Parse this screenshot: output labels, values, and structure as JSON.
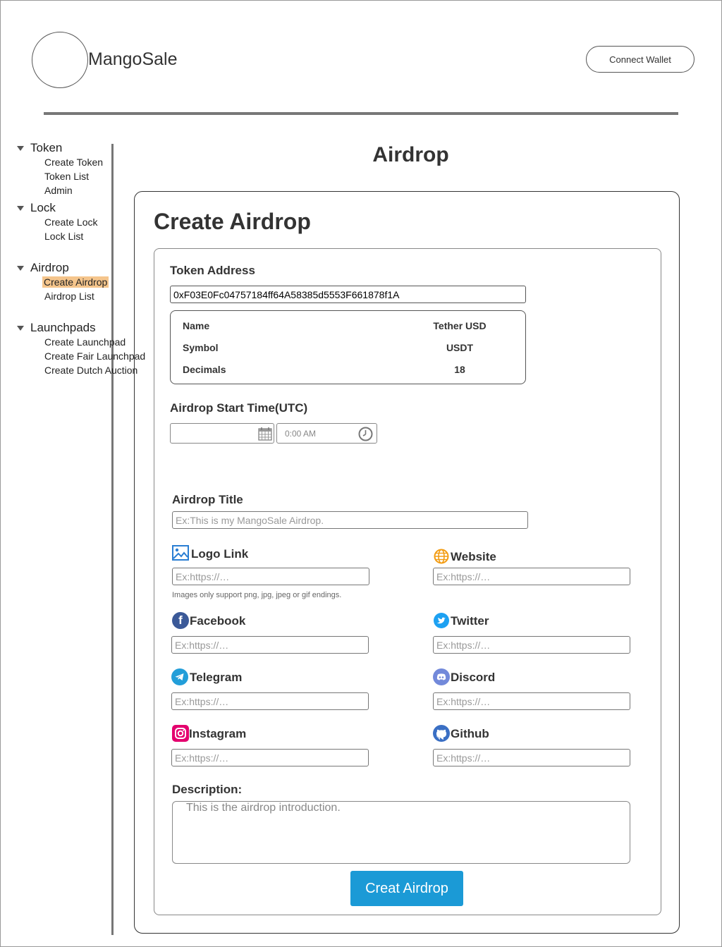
{
  "header": {
    "brand": "MangoSale",
    "connect_wallet": "Connect Wallet"
  },
  "sidebar": {
    "groups": [
      {
        "label": "Token",
        "items": [
          "Create Token",
          "Token List",
          "Admin"
        ]
      },
      {
        "label": "Lock",
        "items": [
          "Create Lock",
          "Lock List"
        ]
      },
      {
        "label": "Airdrop",
        "items": [
          "Create Airdrop",
          "Airdrop List"
        ],
        "active_item": "Create Airdrop"
      },
      {
        "label": "Launchpads",
        "items": [
          "Create Launchpad",
          "Create Fair Launchpad",
          "Create Dutch Auction"
        ]
      }
    ]
  },
  "page": {
    "title": "Airdrop",
    "card_title": "Create Airdrop"
  },
  "form": {
    "token_address_label": "Token Address",
    "token_address_value": "0xF03E0Fc04757184ff64A58385d5553F661878f1A",
    "token_info": {
      "name_key": "Name",
      "name_val": "Tether USD",
      "symbol_key": "Symbol",
      "symbol_val": "USDT",
      "decimals_key": "Decimals",
      "decimals_val": "18"
    },
    "start_time_label": "Airdrop Start Time(UTC)",
    "date_value": "",
    "time_value": "0:00 AM",
    "title_label": "Airdrop Title",
    "title_placeholder": "Ex:This is my MangoSale Airdrop.",
    "logo_label": "Logo Link",
    "logo_hint": "Images only support png, jpg, jpeg or gif endings.",
    "website_label": "Website",
    "facebook_label": "Facebook",
    "twitter_label": "Twitter",
    "telegram_label": "Telegram",
    "discord_label": "Discord",
    "instagram_label": "Instagram",
    "github_label": "Github",
    "link_placeholder": "Ex:https://…",
    "description_label": "Description:",
    "description_placeholder": "This is the airdrop introduction.",
    "submit_label": "Creat Airdrop"
  },
  "colors": {
    "accent": "#1b9ad6",
    "active_nav": "#f5c58c",
    "facebook": "#3b5998",
    "twitter": "#1da1f2",
    "telegram": "#229ed9",
    "discord": "#7289da",
    "instagram": "#e4006e",
    "github": "#3a6fc4",
    "website": "#f39c12"
  },
  "icons": [
    "image-icon",
    "globe-icon",
    "facebook-icon",
    "twitter-icon",
    "telegram-icon",
    "discord-icon",
    "instagram-icon",
    "github-icon",
    "calendar-icon",
    "clock-icon"
  ]
}
